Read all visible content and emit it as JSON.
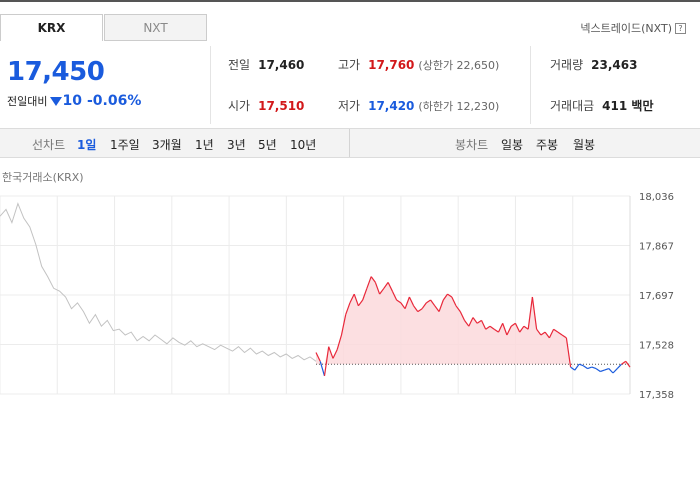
{
  "tabs": {
    "krx": "KRX",
    "nxt": "NXT"
  },
  "nxt_link": {
    "label": "넥스트레이드(NXT)",
    "help": "?"
  },
  "quote": {
    "price": "17,450",
    "change_label": "전일대비",
    "change_value": "10",
    "change_pct": "-0.06%"
  },
  "stats": {
    "prev_close": {
      "label": "전일",
      "value": "17,460"
    },
    "open": {
      "label": "시가",
      "value": "17,510"
    },
    "high": {
      "label": "고가",
      "value": "17,760",
      "note": "(상한가 22,650)"
    },
    "low": {
      "label": "저가",
      "value": "17,420",
      "note": "(하한가 12,230)"
    },
    "volume": {
      "label": "거래량",
      "value": "23,463"
    },
    "amount": {
      "label": "거래대금",
      "value": "411 백만"
    }
  },
  "periods": {
    "label": "선차트",
    "items": [
      "1일",
      "1주일",
      "3개월",
      "1년",
      "3년",
      "5년",
      "10년"
    ],
    "active": "1일"
  },
  "candles": {
    "label": "봉차트",
    "items": [
      "일봉",
      "주봉",
      "월봉"
    ]
  },
  "exchange_label": "한국거래소(KRX)",
  "colors": {
    "up": "#e8283a",
    "down": "#1a5bdd",
    "area": "#fbd9dc"
  },
  "chart_data": {
    "type": "line",
    "y_ticks": [
      "18,036",
      "17,867",
      "17,697",
      "17,528",
      "17,358"
    ],
    "ylim": [
      17358,
      18036
    ],
    "reference": 17460,
    "premarket": [
      17967,
      17990,
      17945,
      18010,
      17960,
      17930,
      17870,
      17795,
      17760,
      17720,
      17710,
      17690,
      17650,
      17670,
      17640,
      17600,
      17630,
      17590,
      17610,
      17575,
      17580,
      17560,
      17570,
      17540,
      17555,
      17540,
      17560,
      17545,
      17530,
      17550,
      17535,
      17525,
      17540,
      17520,
      17530,
      17520,
      17510,
      17525,
      17515,
      17505,
      17520,
      17500,
      17515,
      17495,
      17505,
      17490,
      17500,
      17485,
      17495,
      17480,
      17490,
      17475,
      17485,
      17470
    ],
    "session": [
      17500,
      17470,
      17420,
      17520,
      17480,
      17510,
      17560,
      17630,
      17670,
      17700,
      17660,
      17680,
      17720,
      17760,
      17740,
      17700,
      17720,
      17740,
      17710,
      17680,
      17670,
      17650,
      17690,
      17660,
      17640,
      17650,
      17670,
      17680,
      17660,
      17640,
      17680,
      17700,
      17690,
      17660,
      17640,
      17610,
      17590,
      17620,
      17600,
      17610,
      17580,
      17590,
      17580,
      17570,
      17600,
      17560,
      17590,
      17600,
      17570,
      17590,
      17580,
      17690,
      17580,
      17560,
      17570,
      17550,
      17580,
      17570,
      17560,
      17550,
      17450,
      17440,
      17460,
      17455,
      17445,
      17450,
      17445,
      17435,
      17440,
      17445,
      17430,
      17445,
      17460,
      17470,
      17450
    ]
  }
}
